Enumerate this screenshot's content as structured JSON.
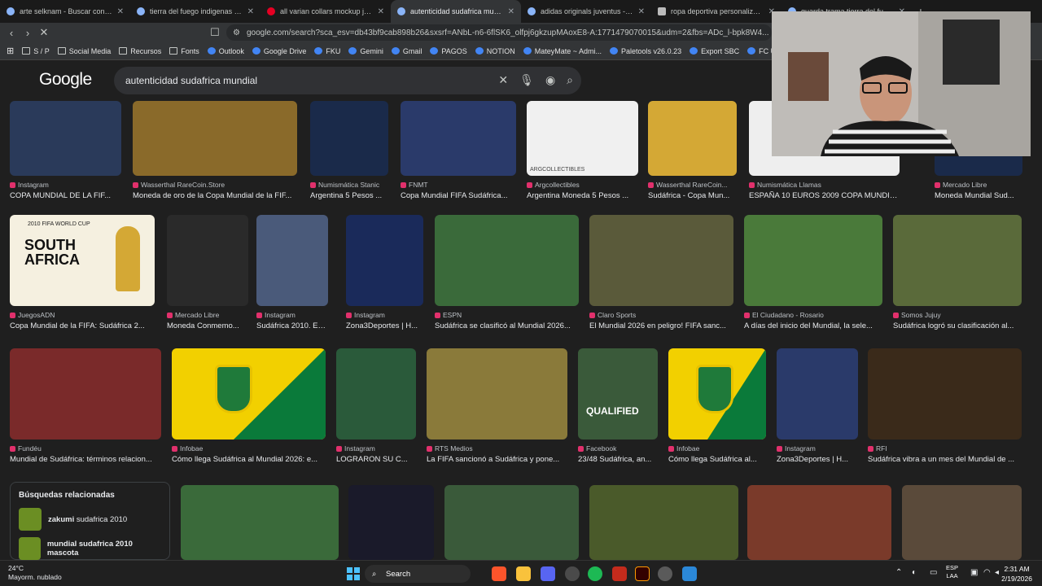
{
  "browser": {
    "tabs": [
      {
        "title": "arte selknam - Buscar con Google",
        "icon": "google-icon",
        "active": false
      },
      {
        "title": "tierra del fuego indigenas - Buscar c",
        "icon": "google-icon",
        "active": false
      },
      {
        "title": "all varian collars mockup jersey 2d",
        "icon": "pinterest-icon",
        "active": false
      },
      {
        "title": "autenticidad sudafrica mundial",
        "icon": "google-icon",
        "active": true
      },
      {
        "title": "adidas originals juventus - Buscar co",
        "icon": "google-icon",
        "active": false
      },
      {
        "title": "ropa deportiva personalizada - one",
        "icon": "notion-icon",
        "active": false
      },
      {
        "title": "guarda trama tierra del fuego - Busc",
        "icon": "google-icon",
        "active": false
      }
    ],
    "url": "google.com/search?sca_esv=db43bf9cab898b26&sxsrf=ANbL-n6-6flSK6_olfpj6gkzupMAoxE8-A:1771479070015&udm=2&fbs=ADc_l-bpk8W4..."
  },
  "bookmarks": [
    "S / P",
    "Social Media",
    "Recursos",
    "Fonts",
    "Outlook",
    "Google Drive",
    "FKU",
    "Gemini",
    "Gmail",
    "PAGOS",
    "NOTION",
    "MateyMate ~ Admi...",
    "Paletools v26.0.23",
    "Export SBC",
    "FC Ultimate"
  ],
  "search": {
    "logo": "Google",
    "query": "autenticidad sudafrica mundial"
  },
  "results": [
    {
      "source": "Instagram",
      "title": "COPA MUNDIAL DE LA FIF...",
      "color": "#2a3a5a"
    },
    {
      "source": "Wasserthal RareCoin.Store",
      "title": "Moneda de oro de la Copa Mundial de la FIF...",
      "color": "#8a6a2a"
    },
    {
      "source": "Numismática Stanic",
      "title": "Argentina 5 Pesos ...",
      "color": "#1a2a4a"
    },
    {
      "source": "FNMT",
      "title": "Copa Mundial FIFA Sudáfrica...",
      "color": "#2a3a6a"
    },
    {
      "source": "Argcollectibles",
      "title": "Argentina Moneda 5 Pesos ...",
      "color": "#f0f0f0"
    },
    {
      "source": "Wasserthal RareCoin...",
      "title": "Sudáfrica - Copa Mun...",
      "color": "#d4a835"
    },
    {
      "source": "Numismática Llamas",
      "title": "ESPAÑA 10 EUROS 2009 COPA MUNDIAL S...",
      "color": "#eeeeee"
    },
    {
      "source": "Mercado Libre",
      "title": "Moneda Mundial Sud...",
      "color": "#1a2a4a"
    },
    {
      "source": "JuegosADN",
      "title": "Copa Mundial de la FIFA: Sudáfrica 2...",
      "color": "#f5f0e0"
    },
    {
      "source": "Mercado Libre",
      "title": "Moneda Conmemo...",
      "color": "#2a2a2a"
    },
    {
      "source": "Instagram",
      "title": "Sudáfrica 2010. Es...",
      "color": "#4a5a7a"
    },
    {
      "source": "Instagram",
      "title": "Zona3Deportes | H...",
      "color": "#1a2a5a"
    },
    {
      "source": "ESPN",
      "title": "Sudáfrica se clasificó al Mundial 2026...",
      "color": "#3a6a3a"
    },
    {
      "source": "Claro Sports",
      "title": "El Mundial 2026 en peligro! FIFA sanc...",
      "color": "#5a5a3a"
    },
    {
      "source": "El Ciudadano - Rosario",
      "title": "A días del inicio del Mundial, la sele...",
      "color": "#4a7a3a"
    },
    {
      "source": "Somos Jujuy",
      "title": "Sudáfrica logró su clasificación al...",
      "color": "#5a6a3a"
    },
    {
      "source": "Fundéu",
      "title": "Mundial de Sudáfrica: términos relacion...",
      "color": "#7a2a2a"
    },
    {
      "source": "Infobae",
      "title": "Cómo llega Sudáfrica al Mundial 2026: e...",
      "color": "#f2d000"
    },
    {
      "source": "Instagram",
      "title": "LOGRARON SU C...",
      "color": "#2a5a3a"
    },
    {
      "source": "RTS Medios",
      "title": "La FIFA sancionó a Sudáfrica y pone...",
      "color": "#8a7a3a"
    },
    {
      "source": "Facebook",
      "title": "23/48 Sudáfrica, an...",
      "color": "#3a5a3a"
    },
    {
      "source": "Infobae",
      "title": "Cómo llega Sudáfrica al...",
      "color": "#f2d000"
    },
    {
      "source": "Instagram",
      "title": "Zona3Deportes | H...",
      "color": "#2a3a6a"
    },
    {
      "source": "RFI",
      "title": "Sudáfrica vibra a un mes del Mundial de ...",
      "color": "#3a2a1a"
    }
  ],
  "image_texts": {
    "south_africa": "SOUTH AFRICA",
    "fifa_world_cup": "2010 FIFA WORLD CUP",
    "qualified": "QUALIFIED",
    "argcollectibles": "ARGCOLLECTIBLES"
  },
  "related": {
    "heading": "Búsquedas relacionadas",
    "items": [
      {
        "bold": "zakumi",
        "rest": " sudafrica 2010"
      },
      {
        "bold": "mundial sudafrica 2010 mascota",
        "rest": ""
      }
    ]
  },
  "taskbar": {
    "weather_temp": "24°C",
    "weather_desc": "Mayorm. nublado",
    "search_label": "Search",
    "lang_top": "ESP",
    "lang_bottom": "LAA",
    "time": "2:31 AM",
    "date": "2/19/2026"
  }
}
